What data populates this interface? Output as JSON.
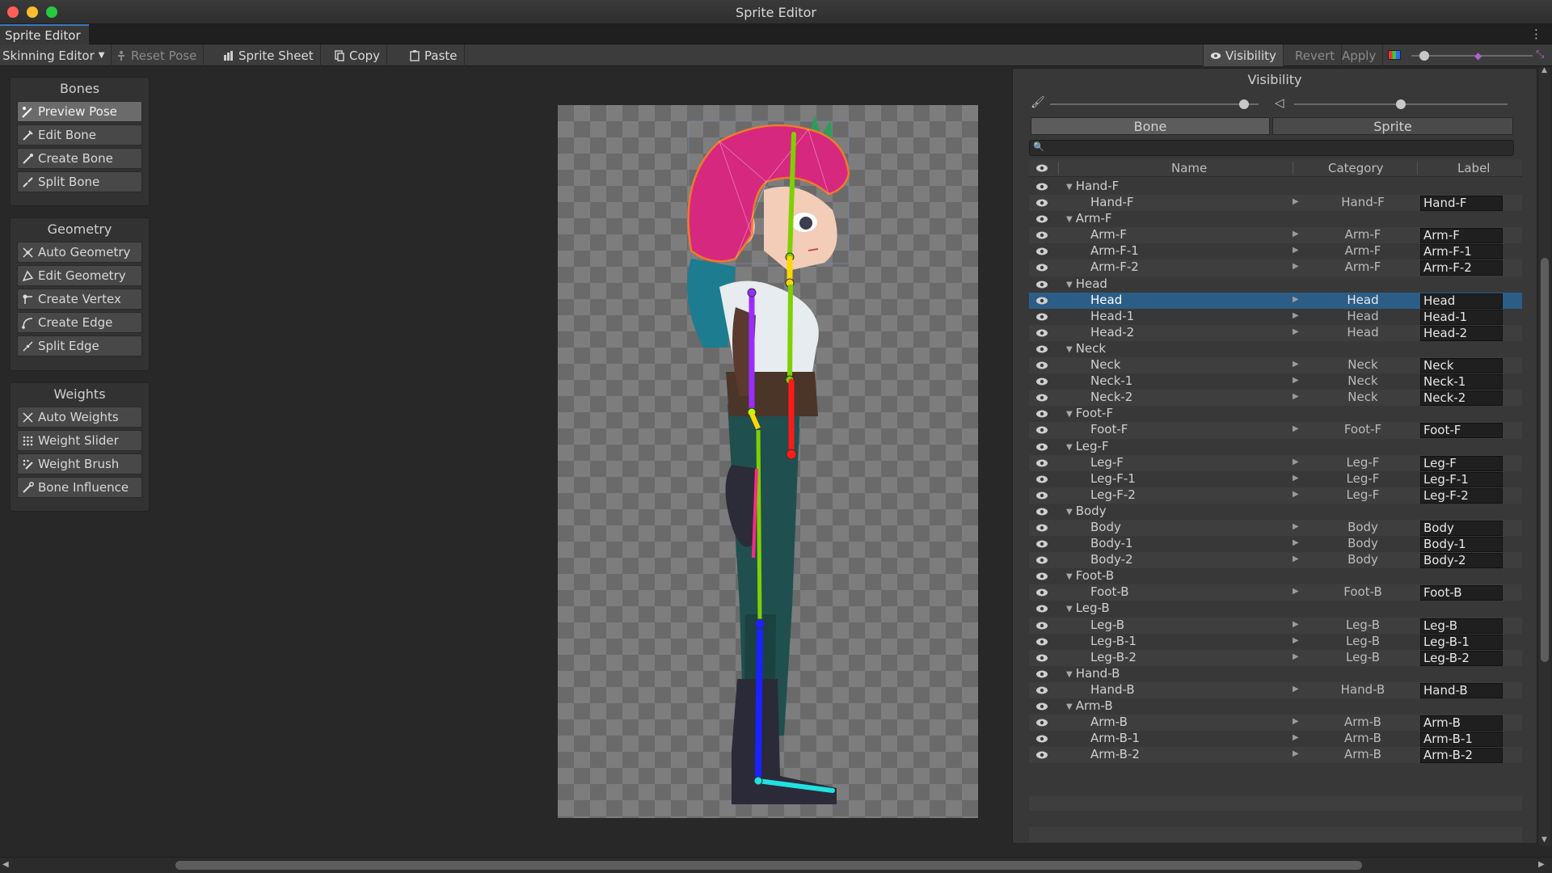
{
  "window": {
    "title": "Sprite Editor",
    "controls": {
      "close_color": "#ff5f57",
      "minimize_color": "#febc2e",
      "maximize_color": "#28c840"
    }
  },
  "tabs": {
    "active": "Sprite Editor",
    "menu_icon": "⋮"
  },
  "toolbar": {
    "mode_dropdown": "Skinning Editor",
    "reset_pose": "Reset Pose",
    "sprite_sheet": "Sprite Sheet",
    "copy": "Copy",
    "paste": "Paste",
    "visibility": "Visibility",
    "revert": "Revert",
    "apply": "Apply"
  },
  "tool_panels": {
    "bones": {
      "title": "Bones",
      "items": [
        "Preview Pose",
        "Edit Bone",
        "Create Bone",
        "Split Bone"
      ]
    },
    "geometry": {
      "title": "Geometry",
      "items": [
        "Auto Geometry",
        "Edit Geometry",
        "Create Vertex",
        "Create Edge",
        "Split Edge"
      ]
    },
    "weights": {
      "title": "Weights",
      "items": [
        "Auto Weights",
        "Weight Slider",
        "Weight Brush",
        "Bone Influence"
      ]
    }
  },
  "visibility_panel": {
    "title": "Visibility",
    "bone_opacity": 0.93,
    "sprite_opacity": 0.5,
    "segments": {
      "bone": "Bone",
      "sprite": "Sprite",
      "selected": "Bone"
    },
    "search_placeholder": "",
    "columns": {
      "name": "Name",
      "category": "Category",
      "label": "Label"
    }
  },
  "rows": [
    {
      "type": "group",
      "name": "Hand-F"
    },
    {
      "type": "bone",
      "name": "Hand-F",
      "category": "Hand-F",
      "label": "Hand-F"
    },
    {
      "type": "group",
      "name": "Arm-F"
    },
    {
      "type": "bone",
      "name": "Arm-F",
      "category": "Arm-F",
      "label": "Arm-F"
    },
    {
      "type": "bone",
      "name": "Arm-F-1",
      "category": "Arm-F",
      "label": "Arm-F-1"
    },
    {
      "type": "bone",
      "name": "Arm-F-2",
      "category": "Arm-F",
      "label": "Arm-F-2"
    },
    {
      "type": "group",
      "name": "Head"
    },
    {
      "type": "bone",
      "name": "Head",
      "category": "Head",
      "label": "Head",
      "selected": true
    },
    {
      "type": "bone",
      "name": "Head-1",
      "category": "Head",
      "label": "Head-1"
    },
    {
      "type": "bone",
      "name": "Head-2",
      "category": "Head",
      "label": "Head-2"
    },
    {
      "type": "group",
      "name": "Neck"
    },
    {
      "type": "bone",
      "name": "Neck",
      "category": "Neck",
      "label": "Neck"
    },
    {
      "type": "bone",
      "name": "Neck-1",
      "category": "Neck",
      "label": "Neck-1"
    },
    {
      "type": "bone",
      "name": "Neck-2",
      "category": "Neck",
      "label": "Neck-2"
    },
    {
      "type": "group",
      "name": "Foot-F"
    },
    {
      "type": "bone",
      "name": "Foot-F",
      "category": "Foot-F",
      "label": "Foot-F"
    },
    {
      "type": "group",
      "name": "Leg-F"
    },
    {
      "type": "bone",
      "name": "Leg-F",
      "category": "Leg-F",
      "label": "Leg-F"
    },
    {
      "type": "bone",
      "name": "Leg-F-1",
      "category": "Leg-F",
      "label": "Leg-F-1"
    },
    {
      "type": "bone",
      "name": "Leg-F-2",
      "category": "Leg-F",
      "label": "Leg-F-2"
    },
    {
      "type": "group",
      "name": "Body"
    },
    {
      "type": "bone",
      "name": "Body",
      "category": "Body",
      "label": "Body"
    },
    {
      "type": "bone",
      "name": "Body-1",
      "category": "Body",
      "label": "Body-1"
    },
    {
      "type": "bone",
      "name": "Body-2",
      "category": "Body",
      "label": "Body-2"
    },
    {
      "type": "group",
      "name": "Foot-B"
    },
    {
      "type": "bone",
      "name": "Foot-B",
      "category": "Foot-B",
      "label": "Foot-B"
    },
    {
      "type": "group",
      "name": "Leg-B"
    },
    {
      "type": "bone",
      "name": "Leg-B",
      "category": "Leg-B",
      "label": "Leg-B"
    },
    {
      "type": "bone",
      "name": "Leg-B-1",
      "category": "Leg-B",
      "label": "Leg-B-1"
    },
    {
      "type": "bone",
      "name": "Leg-B-2",
      "category": "Leg-B",
      "label": "Leg-B-2"
    },
    {
      "type": "group",
      "name": "Hand-B"
    },
    {
      "type": "bone",
      "name": "Hand-B",
      "category": "Hand-B",
      "label": "Hand-B"
    },
    {
      "type": "group",
      "name": "Arm-B"
    },
    {
      "type": "bone",
      "name": "Arm-B",
      "category": "Arm-B",
      "label": "Arm-B"
    },
    {
      "type": "bone",
      "name": "Arm-B-1",
      "category": "Arm-B",
      "label": "Arm-B-1"
    },
    {
      "type": "bone",
      "name": "Arm-B-2",
      "category": "Arm-B",
      "label": "Arm-B-2"
    }
  ],
  "icons": {
    "eye": "eye-icon",
    "row_expand": "play-triangle-icon",
    "bone_tool": "bone-icon",
    "brush": "brush-icon",
    "sprite": "sprite-icon",
    "search": "search-icon"
  },
  "colors": {
    "accent_tab": "#3a79bb",
    "selection": "#2c5d87",
    "bone_head": "#7fd000",
    "bone_neck": "#ffd800",
    "bone_armf": "#ff1a1a",
    "bone_armb": "#9a2cff",
    "bone_legf": "#1a22ff",
    "bone_foot": "#22e0e0",
    "hair": "#d6287e"
  }
}
